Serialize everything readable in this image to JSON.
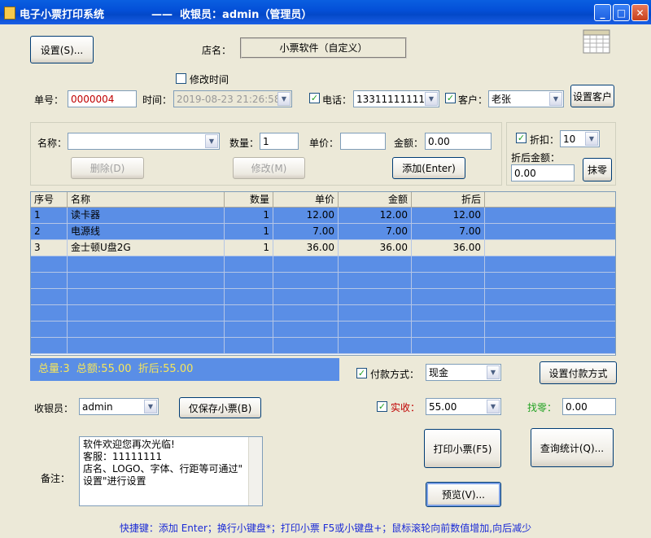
{
  "window": {
    "title": "电子小票打印系统",
    "subtitle": "——  收银员：admin（管理员）",
    "minimize": "_",
    "maximize": "□",
    "close": "✕"
  },
  "top": {
    "settings_button": "设置(S)...",
    "store_label": "店名：",
    "store_name": "小票软件（自定义）"
  },
  "order": {
    "modify_time_label": "修改时间",
    "number_label": "单号：",
    "number_value": "0000004",
    "time_label": "时间：",
    "time_value": "2019-08-23 21:26:58",
    "phone_label": "电话：",
    "phone_value": "13311111111",
    "customer_label": "客户：",
    "customer_value": "老张",
    "set_customer_button": "设置客户"
  },
  "item": {
    "name_label": "名称：",
    "name_value": "",
    "qty_label": "数量：",
    "qty_value": "1",
    "price_label": "单价：",
    "price_value": "",
    "amount_label": "金额：",
    "amount_value": "0.00",
    "delete_button": "删除(D)",
    "modify_button": "修改(M)",
    "add_button": "添加(Enter)"
  },
  "discount": {
    "label": "折扣：",
    "value": "10",
    "after_label": "折后金额：",
    "after_value": "0.00",
    "round_button": "抹零"
  },
  "table": {
    "headers": [
      "序号",
      "名称",
      "数量",
      "单价",
      "金额",
      "折后"
    ],
    "rows": [
      [
        "1",
        "读卡器",
        "1",
        "12.00",
        "12.00",
        "12.00"
      ],
      [
        "2",
        "电源线",
        "1",
        "7.00",
        "7.00",
        "7.00"
      ],
      [
        "3",
        "金士顿U盘2G",
        "1",
        "36.00",
        "36.00",
        "36.00"
      ]
    ]
  },
  "summary": {
    "text": "总量:3  总额:55.00  折后:55.00"
  },
  "payment": {
    "method_label": "付款方式：",
    "method_value": "现金",
    "set_method_button": "设置付款方式",
    "received_label": "实收：",
    "received_value": "55.00",
    "change_label": "找零：",
    "change_value": "0.00"
  },
  "cashier": {
    "label": "收银员：",
    "value": "admin",
    "save_only_button": "仅保存小票(B)"
  },
  "memo": {
    "label": "备注：",
    "line1": "软件欢迎您再次光临!",
    "line2": "客服：11111111",
    "line3": "店名、LOGO、字体、行距等可通过\"",
    "line4": "设置\"进行设置"
  },
  "actions": {
    "print_button": "打印小票(F5)",
    "query_button": "查询统计(Q)...",
    "preview_button": "预览(V)..."
  },
  "footer": {
    "hint": "快捷键：添加 Enter；换行小键盘*；打印小票 F5或小键盘+；鼠标滚轮向前数值增加,向后减少"
  },
  "colors": {
    "title_bar": "#0450d8",
    "grid_selected": "#5a8ee6",
    "summary_text": "#f7e65a",
    "received_label": "#c00000",
    "change_label": "#21a121",
    "footer_text": "#1b2bd6"
  },
  "icons": {
    "calendar": "calendar-icon"
  }
}
